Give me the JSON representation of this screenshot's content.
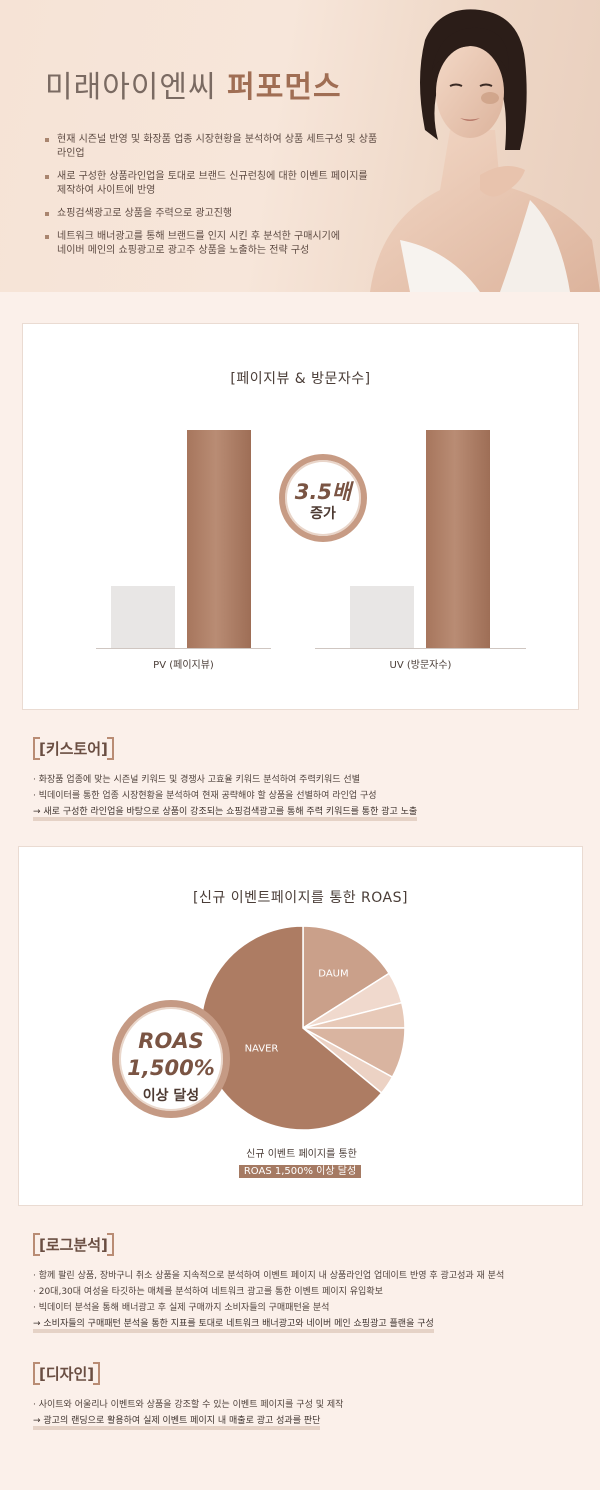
{
  "hero": {
    "title_light": "미래아이엔씨",
    "title_bold": "퍼포먼스",
    "bullets": [
      {
        "lines": [
          "현재 시즌널 반영 및 화장품 업종 시장현황을 분석하여 상품 세트구성 및 상품 라인업"
        ]
      },
      {
        "lines": [
          "새로 구성한 상품라인업을 토대로 브랜드 신규런칭에 대한 이벤트 페이지를",
          "제작하여 사이트에 반영"
        ]
      },
      {
        "lines": [
          "쇼핑검색광고로 상품을 주력으로 광고진행"
        ]
      },
      {
        "lines": [
          "네트워크 배너광고를 통해 브랜드를 인지 시킨 후 분석한 구매시기에",
          "네이버 메인의 쇼핑광고로 광고주 상품을 노출하는 전략 구성"
        ]
      }
    ]
  },
  "chart1": {
    "title": "[페이지뷰 & 방문자수]",
    "badge_value": "3.5배",
    "badge_label": "증가"
  },
  "chart2": {
    "title": "[신규 이벤트페이지를 통한 ROAS]",
    "badge_line1": "ROAS",
    "badge_line2": "1,500%",
    "badge_line3": "이상 달성",
    "caption_line1": "신규 이벤트 페이지를 통한",
    "caption_line2": "ROAS 1,500% 이상 달성"
  },
  "chart_data": [
    {
      "type": "bar",
      "title": "[페이지뷰 & 방문자수]",
      "categories": [
        "PV (페이지뷰)",
        "UV (방문자수)"
      ],
      "series": [
        {
          "values": [
            1,
            1
          ]
        },
        {
          "values": [
            3.5,
            3.5
          ]
        }
      ],
      "ylim": [
        0,
        3.5
      ],
      "colors": [
        "#e8e6e5",
        "#a7765d"
      ],
      "grid": false
    },
    {
      "type": "pie",
      "title": "[신규 이벤트페이지를 통한 ROAS]",
      "slices": [
        {
          "label": "DAUM",
          "value": 16,
          "color": "#caa08a"
        },
        {
          "label": "",
          "value": 5,
          "color": "#f0d9cd"
        },
        {
          "label": "",
          "value": 4,
          "color": "#e7c9b8"
        },
        {
          "label": "",
          "value": 8,
          "color": "#d9b4a0"
        },
        {
          "label": "",
          "value": 3,
          "color": "#ecd2c4"
        },
        {
          "label": "NAVER",
          "value": 64,
          "color": "#ad7c63"
        }
      ]
    }
  ],
  "kisstore": {
    "heading": "[키스토어]",
    "items": [
      {
        "text": "· 화장품 업종에 맞는 시즌널 키워드 및 경쟁사 고효율 키워드 분석하여 주력키워드 선별",
        "arrow": false
      },
      {
        "text": "· 빅데이터를 통한 업종 시장현황을 분석하여 현재 공략해야 할 상품을 선별하여 라인업 구성",
        "arrow": false
      },
      {
        "text": "→ 새로 구성한 라인업을 바탕으로 상품이 강조되는 쇼핑검색광고를 통해 주력 키워드를 통한 광고 노출",
        "arrow": true
      }
    ]
  },
  "log": {
    "heading": "[로그분석]",
    "items": [
      {
        "text": "· 함께 팔린 상품, 장바구니 취소 상품을 지속적으로 분석하여 이벤트 페이지 내 상품라인업 업데이트 반영 후 광고성과 재 분석",
        "arrow": false
      },
      {
        "text": "· 20대,30대 여성을 타깃하는 매체를 분석하여 네트워크 광고를 통한 이벤트 페이지 유입확보",
        "arrow": false
      },
      {
        "text": "· 빅데이터 분석을 통해 배너광고 후 실제 구매까지 소비자들의 구매패턴을 분석",
        "arrow": false
      },
      {
        "text": "→ 소비자들의 구매패턴 분석을 통한 지표를 토대로 네트워크 배너광고와 네이버 메인 쇼핑광고 플랜을 구성",
        "arrow": true
      }
    ]
  },
  "design": {
    "heading": "[디자인]",
    "items": [
      {
        "text": "· 사이트와 어울리나 이벤트와 상품을 강조할 수 있는 이벤트 페이지를 구성 및 제작",
        "arrow": false
      },
      {
        "text": "→ 광고의 랜딩으로 활용하여 실제 이벤트 페이지 내 매출로 광고 성과를 판단",
        "arrow": true
      }
    ]
  }
}
